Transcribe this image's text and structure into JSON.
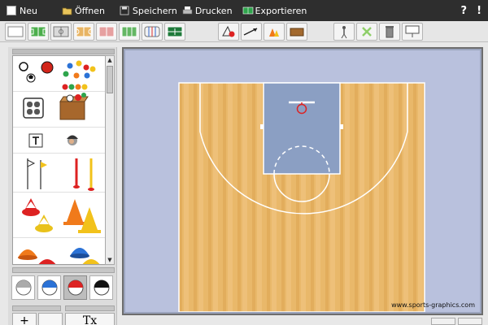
{
  "menu": {
    "new": "Neu",
    "open": "Öffnen",
    "save": "Speichern",
    "print": "Drucken",
    "export": "Exportieren",
    "help": "?",
    "exclamation": "!"
  },
  "palette": {
    "bottom_buttons": [
      "+",
      "Tx"
    ]
  },
  "canvas": {
    "watermark": "www.sports-graphics.com"
  },
  "colors": {
    "court_wood": "#e9b86a",
    "key_blue": "#8b9fc3",
    "canvas_bg": "#b9c1dd",
    "menubar": "#2e2e2e"
  }
}
